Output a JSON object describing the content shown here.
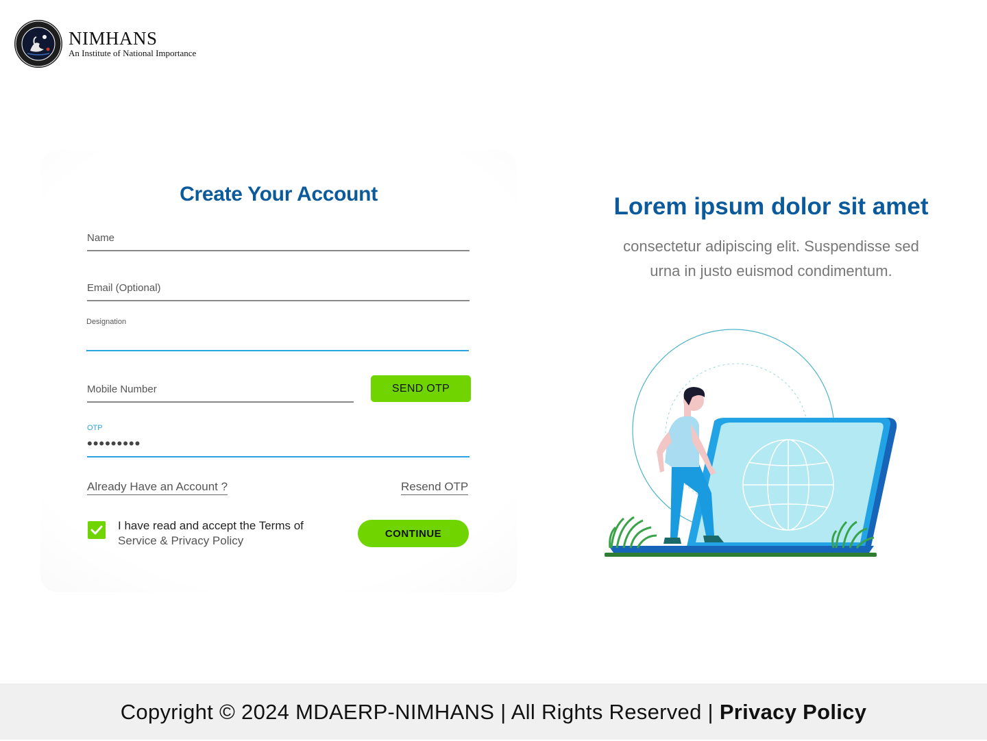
{
  "brand": {
    "name": "NIMHANS",
    "tagline": "An Institute of National Importance"
  },
  "form": {
    "title": "Create Your Account",
    "name_label": "Name",
    "email_label": "Email (Optional)",
    "designation_label": "Designation",
    "mobile_label": "Mobile Number",
    "send_otp_label": "SEND OTP",
    "otp_label": "OTP",
    "otp_value": "•••••••••",
    "already_account_link": "Already Have an Account ?",
    "resend_otp_link": "Resend OTP",
    "terms_line1": "I have read and accept the Terms of",
    "terms_line2": "Service & Privacy Policy",
    "terms_checked": true,
    "continue_label": "CONTINUE"
  },
  "hero": {
    "title": "Lorem ipsum dolor sit amet",
    "subtitle_line1": "consectetur adipiscing elit. Suspendisse sed",
    "subtitle_line2": "urna in justo euismod condimentum."
  },
  "footer": {
    "copyright": "Copyright © 2024 MDAERP-NIMHANS |  All Rights Reserved | ",
    "privacy_link": "Privacy Policy"
  },
  "colors": {
    "accent_blue": "#0a5a9c",
    "button_green": "#6fd400",
    "field_active": "#2aa4e0"
  }
}
